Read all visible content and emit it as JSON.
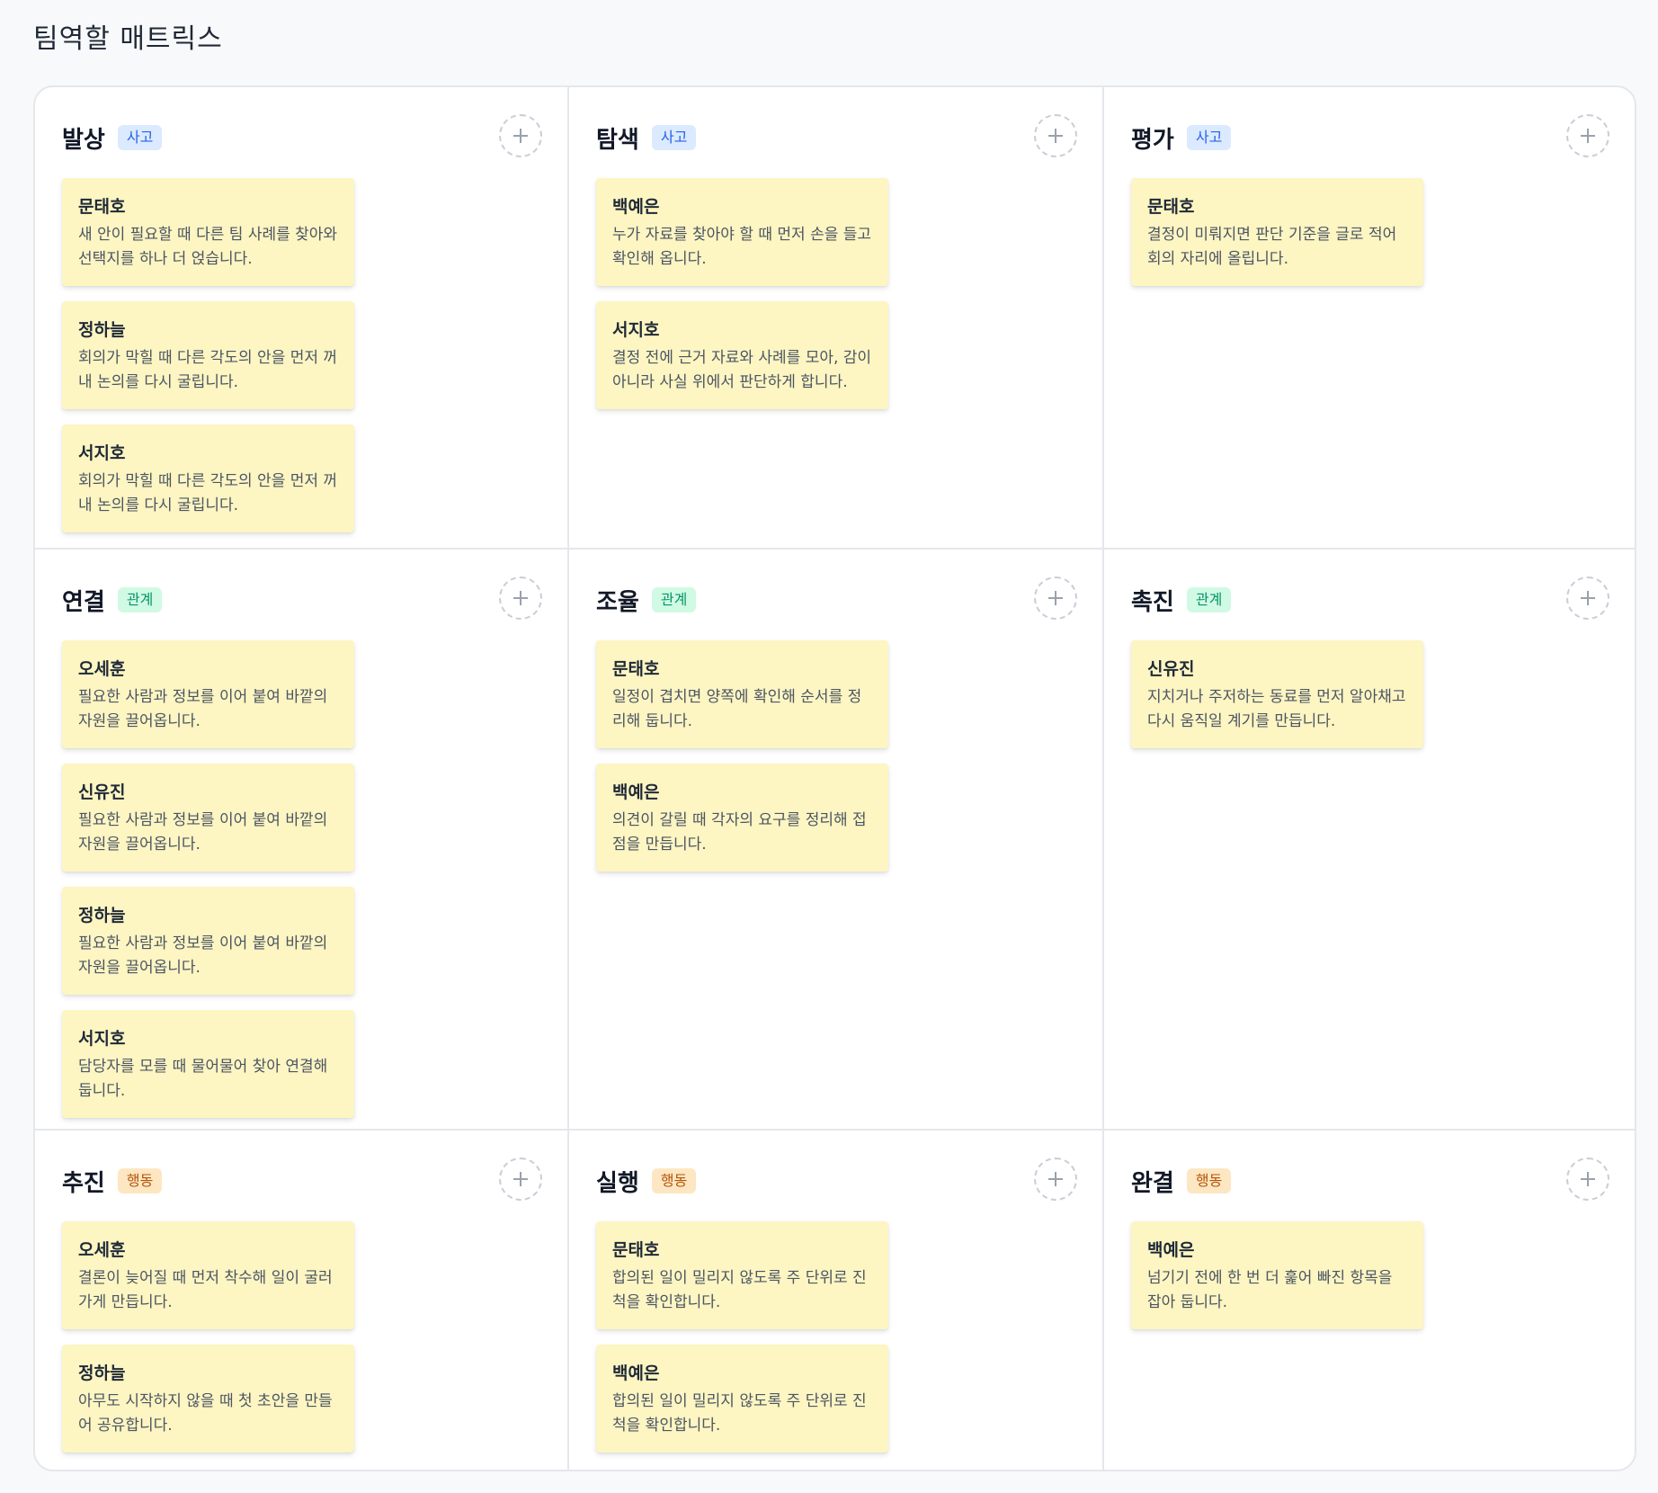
{
  "page_title": "팀역할 매트릭스",
  "cells": [
    {
      "title": "발상",
      "category": "사고",
      "notes": [
        {
          "name": "문태호",
          "text": "새 안이 필요할 때 다른 팀 사례를 찾아와 선택지를 하나 더 얹습니다."
        },
        {
          "name": "정하늘",
          "text": "회의가 막힐 때 다른 각도의 안을 먼저 꺼내 논의를 다시 굴립니다."
        },
        {
          "name": "서지호",
          "text": "회의가 막힐 때 다른 각도의 안을 먼저 꺼내 논의를 다시 굴립니다."
        }
      ]
    },
    {
      "title": "탐색",
      "category": "사고",
      "notes": [
        {
          "name": "백예은",
          "text": "누가 자료를 찾아야 할 때 먼저 손을 들고 확인해 옵니다."
        },
        {
          "name": "서지호",
          "text": "결정 전에 근거 자료와 사례를 모아, 감이 아니라 사실 위에서 판단하게 합니다."
        }
      ]
    },
    {
      "title": "평가",
      "category": "사고",
      "notes": [
        {
          "name": "문태호",
          "text": "결정이 미뤄지면 판단 기준을 글로 적어 회의 자리에 올립니다."
        }
      ]
    },
    {
      "title": "연결",
      "category": "관계",
      "notes": [
        {
          "name": "오세훈",
          "text": "필요한 사람과 정보를 이어 붙여 바깥의 자원을 끌어옵니다."
        },
        {
          "name": "신유진",
          "text": "필요한 사람과 정보를 이어 붙여 바깥의 자원을 끌어옵니다."
        },
        {
          "name": "정하늘",
          "text": "필요한 사람과 정보를 이어 붙여 바깥의 자원을 끌어옵니다."
        },
        {
          "name": "서지호",
          "text": "담당자를 모를 때 물어물어 찾아 연결해 둡니다."
        }
      ]
    },
    {
      "title": "조율",
      "category": "관계",
      "notes": [
        {
          "name": "문태호",
          "text": "일정이 겹치면 양쪽에 확인해 순서를 정리해 둡니다."
        },
        {
          "name": "백예은",
          "text": "의견이 갈릴 때 각자의 요구를 정리해 접점을 만듭니다."
        }
      ]
    },
    {
      "title": "촉진",
      "category": "관계",
      "notes": [
        {
          "name": "신유진",
          "text": "지치거나 주저하는 동료를 먼저 알아채고 다시 움직일 계기를 만듭니다."
        }
      ]
    },
    {
      "title": "추진",
      "category": "행동",
      "notes": [
        {
          "name": "오세훈",
          "text": "결론이 늦어질 때 먼저 착수해 일이 굴러가게 만듭니다."
        },
        {
          "name": "정하늘",
          "text": "아무도 시작하지 않을 때 첫 초안을 만들어 공유합니다."
        }
      ]
    },
    {
      "title": "실행",
      "category": "행동",
      "notes": [
        {
          "name": "문태호",
          "text": "합의된 일이 밀리지 않도록 주 단위로 진척을 확인합니다."
        },
        {
          "name": "백예은",
          "text": "합의된 일이 밀리지 않도록 주 단위로 진척을 확인합니다."
        }
      ]
    },
    {
      "title": "완결",
      "category": "행동",
      "notes": [
        {
          "name": "백예은",
          "text": "넘기기 전에 한 번 더 훑어 빠진 항목을 잡아 둡니다."
        }
      ]
    }
  ],
  "colors": {
    "note_bg": "#fdf5c2",
    "thinking_badge": "#dbeafe",
    "relation_badge": "#d1fae5",
    "action_badge": "#fde7c2"
  },
  "icons": {
    "add": "plus-icon"
  }
}
